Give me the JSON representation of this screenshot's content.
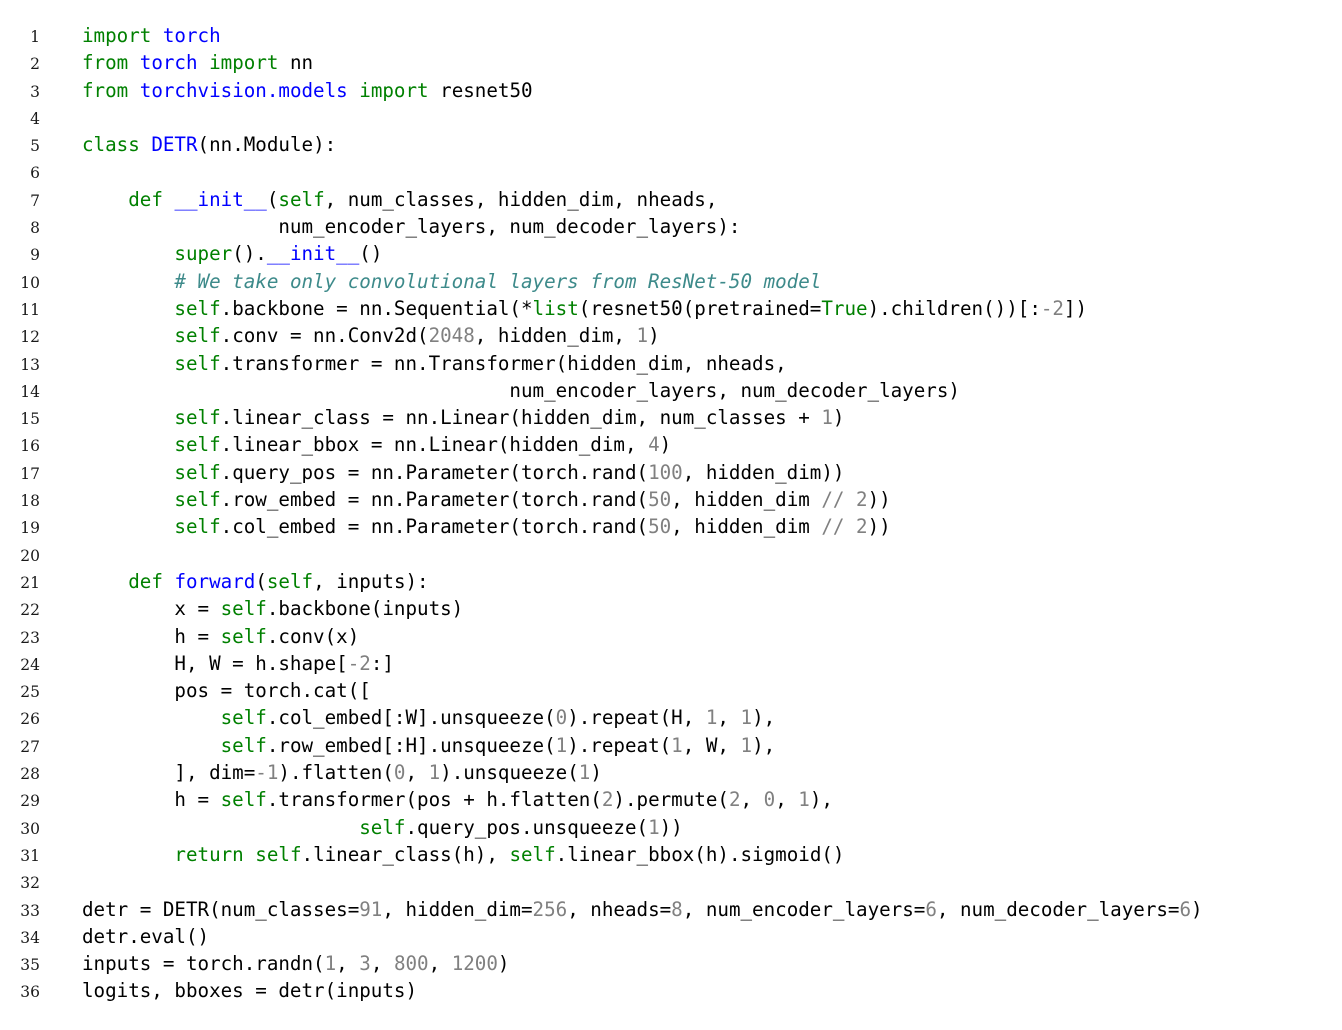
{
  "listing": {
    "language": "python",
    "title": "DETR PyTorch implementation",
    "colors": {
      "background": "#ffffff",
      "plain": "#000000",
      "keyword": "#008000",
      "definition": "#0000ff",
      "number": "#808080",
      "comment": "#3d8a8a",
      "lineno": "#1a1a1a"
    },
    "lines": [
      {
        "n": "1",
        "tokens": [
          {
            "t": "kw",
            "s": "import"
          },
          {
            "t": "pl",
            "s": " "
          },
          {
            "t": "name",
            "s": "torch"
          }
        ]
      },
      {
        "n": "2",
        "tokens": [
          {
            "t": "kw",
            "s": "from"
          },
          {
            "t": "pl",
            "s": " "
          },
          {
            "t": "name",
            "s": "torch"
          },
          {
            "t": "pl",
            "s": " "
          },
          {
            "t": "kw",
            "s": "import"
          },
          {
            "t": "pl",
            "s": " nn"
          }
        ]
      },
      {
        "n": "3",
        "tokens": [
          {
            "t": "kw",
            "s": "from"
          },
          {
            "t": "pl",
            "s": " "
          },
          {
            "t": "name",
            "s": "torchvision.models"
          },
          {
            "t": "pl",
            "s": " "
          },
          {
            "t": "kw",
            "s": "import"
          },
          {
            "t": "pl",
            "s": " resnet50"
          }
        ]
      },
      {
        "n": "4",
        "tokens": []
      },
      {
        "n": "5",
        "tokens": [
          {
            "t": "kw",
            "s": "class"
          },
          {
            "t": "pl",
            "s": " "
          },
          {
            "t": "name",
            "s": "DETR"
          },
          {
            "t": "pl",
            "s": "(nn.Module):"
          }
        ]
      },
      {
        "n": "6",
        "tokens": []
      },
      {
        "n": "7",
        "tokens": [
          {
            "t": "pl",
            "s": "    "
          },
          {
            "t": "kw",
            "s": "def"
          },
          {
            "t": "pl",
            "s": " "
          },
          {
            "t": "name",
            "s": "__init__"
          },
          {
            "t": "pl",
            "s": "("
          },
          {
            "t": "kw",
            "s": "self"
          },
          {
            "t": "pl",
            "s": ", num_classes, hidden_dim, nheads,"
          }
        ]
      },
      {
        "n": "8",
        "tokens": [
          {
            "t": "pl",
            "s": "                 num_encoder_layers, num_decoder_layers):"
          }
        ]
      },
      {
        "n": "9",
        "tokens": [
          {
            "t": "pl",
            "s": "        "
          },
          {
            "t": "kw",
            "s": "super"
          },
          {
            "t": "pl",
            "s": "()."
          },
          {
            "t": "name",
            "s": "__init__"
          },
          {
            "t": "pl",
            "s": "()"
          }
        ]
      },
      {
        "n": "10",
        "tokens": [
          {
            "t": "pl",
            "s": "        "
          },
          {
            "t": "cmt",
            "s": "# We take only convolutional layers from ResNet-50 model"
          }
        ]
      },
      {
        "n": "11",
        "tokens": [
          {
            "t": "pl",
            "s": "        "
          },
          {
            "t": "kw",
            "s": "self"
          },
          {
            "t": "pl",
            "s": ".backbone = nn.Sequential(*"
          },
          {
            "t": "kw",
            "s": "list"
          },
          {
            "t": "pl",
            "s": "(resnet50(pretrained="
          },
          {
            "t": "kw",
            "s": "True"
          },
          {
            "t": "pl",
            "s": ").children())["
          },
          {
            "t": "pl",
            "s": ":"
          },
          {
            "t": "num",
            "s": "-2"
          },
          {
            "t": "pl",
            "s": "])"
          }
        ]
      },
      {
        "n": "12",
        "tokens": [
          {
            "t": "pl",
            "s": "        "
          },
          {
            "t": "kw",
            "s": "self"
          },
          {
            "t": "pl",
            "s": ".conv = nn.Conv2d("
          },
          {
            "t": "num",
            "s": "2048"
          },
          {
            "t": "pl",
            "s": ", hidden_dim, "
          },
          {
            "t": "num",
            "s": "1"
          },
          {
            "t": "pl",
            "s": ")"
          }
        ]
      },
      {
        "n": "13",
        "tokens": [
          {
            "t": "pl",
            "s": "        "
          },
          {
            "t": "kw",
            "s": "self"
          },
          {
            "t": "pl",
            "s": ".transformer = nn.Transformer(hidden_dim, nheads,"
          }
        ]
      },
      {
        "n": "14",
        "tokens": [
          {
            "t": "pl",
            "s": "                                     num_encoder_layers, num_decoder_layers)"
          }
        ]
      },
      {
        "n": "15",
        "tokens": [
          {
            "t": "pl",
            "s": "        "
          },
          {
            "t": "kw",
            "s": "self"
          },
          {
            "t": "pl",
            "s": ".linear_class = nn.Linear(hidden_dim, num_classes + "
          },
          {
            "t": "num",
            "s": "1"
          },
          {
            "t": "pl",
            "s": ")"
          }
        ]
      },
      {
        "n": "16",
        "tokens": [
          {
            "t": "pl",
            "s": "        "
          },
          {
            "t": "kw",
            "s": "self"
          },
          {
            "t": "pl",
            "s": ".linear_bbox = nn.Linear(hidden_dim, "
          },
          {
            "t": "num",
            "s": "4"
          },
          {
            "t": "pl",
            "s": ")"
          }
        ]
      },
      {
        "n": "17",
        "tokens": [
          {
            "t": "pl",
            "s": "        "
          },
          {
            "t": "kw",
            "s": "self"
          },
          {
            "t": "pl",
            "s": ".query_pos = nn.Parameter(torch.rand("
          },
          {
            "t": "num",
            "s": "100"
          },
          {
            "t": "pl",
            "s": ", hidden_dim))"
          }
        ]
      },
      {
        "n": "18",
        "tokens": [
          {
            "t": "pl",
            "s": "        "
          },
          {
            "t": "kw",
            "s": "self"
          },
          {
            "t": "pl",
            "s": ".row_embed = nn.Parameter(torch.rand("
          },
          {
            "t": "num",
            "s": "50"
          },
          {
            "t": "pl",
            "s": ", hidden_dim "
          },
          {
            "t": "num",
            "s": "//"
          },
          {
            "t": "pl",
            "s": " "
          },
          {
            "t": "num",
            "s": "2"
          },
          {
            "t": "pl",
            "s": "))"
          }
        ]
      },
      {
        "n": "19",
        "tokens": [
          {
            "t": "pl",
            "s": "        "
          },
          {
            "t": "kw",
            "s": "self"
          },
          {
            "t": "pl",
            "s": ".col_embed = nn.Parameter(torch.rand("
          },
          {
            "t": "num",
            "s": "50"
          },
          {
            "t": "pl",
            "s": ", hidden_dim "
          },
          {
            "t": "num",
            "s": "//"
          },
          {
            "t": "pl",
            "s": " "
          },
          {
            "t": "num",
            "s": "2"
          },
          {
            "t": "pl",
            "s": "))"
          }
        ]
      },
      {
        "n": "20",
        "tokens": []
      },
      {
        "n": "21",
        "tokens": [
          {
            "t": "pl",
            "s": "    "
          },
          {
            "t": "kw",
            "s": "def"
          },
          {
            "t": "pl",
            "s": " "
          },
          {
            "t": "name",
            "s": "forward"
          },
          {
            "t": "pl",
            "s": "("
          },
          {
            "t": "kw",
            "s": "self"
          },
          {
            "t": "pl",
            "s": ", inputs):"
          }
        ]
      },
      {
        "n": "22",
        "tokens": [
          {
            "t": "pl",
            "s": "        x = "
          },
          {
            "t": "kw",
            "s": "self"
          },
          {
            "t": "pl",
            "s": ".backbone(inputs)"
          }
        ]
      },
      {
        "n": "23",
        "tokens": [
          {
            "t": "pl",
            "s": "        h = "
          },
          {
            "t": "kw",
            "s": "self"
          },
          {
            "t": "pl",
            "s": ".conv(x)"
          }
        ]
      },
      {
        "n": "24",
        "tokens": [
          {
            "t": "pl",
            "s": "        H, W = h.shape["
          },
          {
            "t": "num",
            "s": "-2"
          },
          {
            "t": "pl",
            "s": ":]"
          }
        ]
      },
      {
        "n": "25",
        "tokens": [
          {
            "t": "pl",
            "s": "        pos = torch.cat(["
          }
        ]
      },
      {
        "n": "26",
        "tokens": [
          {
            "t": "pl",
            "s": "            "
          },
          {
            "t": "kw",
            "s": "self"
          },
          {
            "t": "pl",
            "s": ".col_embed[:W].unsqueeze("
          },
          {
            "t": "num",
            "s": "0"
          },
          {
            "t": "pl",
            "s": ").repeat(H, "
          },
          {
            "t": "num",
            "s": "1"
          },
          {
            "t": "pl",
            "s": ", "
          },
          {
            "t": "num",
            "s": "1"
          },
          {
            "t": "pl",
            "s": "),"
          }
        ]
      },
      {
        "n": "27",
        "tokens": [
          {
            "t": "pl",
            "s": "            "
          },
          {
            "t": "kw",
            "s": "self"
          },
          {
            "t": "pl",
            "s": ".row_embed[:H].unsqueeze("
          },
          {
            "t": "num",
            "s": "1"
          },
          {
            "t": "pl",
            "s": ").repeat("
          },
          {
            "t": "num",
            "s": "1"
          },
          {
            "t": "pl",
            "s": ", W, "
          },
          {
            "t": "num",
            "s": "1"
          },
          {
            "t": "pl",
            "s": "),"
          }
        ]
      },
      {
        "n": "28",
        "tokens": [
          {
            "t": "pl",
            "s": "        ], dim="
          },
          {
            "t": "num",
            "s": "-1"
          },
          {
            "t": "pl",
            "s": ").flatten("
          },
          {
            "t": "num",
            "s": "0"
          },
          {
            "t": "pl",
            "s": ", "
          },
          {
            "t": "num",
            "s": "1"
          },
          {
            "t": "pl",
            "s": ").unsqueeze("
          },
          {
            "t": "num",
            "s": "1"
          },
          {
            "t": "pl",
            "s": ")"
          }
        ]
      },
      {
        "n": "29",
        "tokens": [
          {
            "t": "pl",
            "s": "        h = "
          },
          {
            "t": "kw",
            "s": "self"
          },
          {
            "t": "pl",
            "s": ".transformer(pos + h.flatten("
          },
          {
            "t": "num",
            "s": "2"
          },
          {
            "t": "pl",
            "s": ").permute("
          },
          {
            "t": "num",
            "s": "2"
          },
          {
            "t": "pl",
            "s": ", "
          },
          {
            "t": "num",
            "s": "0"
          },
          {
            "t": "pl",
            "s": ", "
          },
          {
            "t": "num",
            "s": "1"
          },
          {
            "t": "pl",
            "s": "),"
          }
        ]
      },
      {
        "n": "30",
        "tokens": [
          {
            "t": "pl",
            "s": "                        "
          },
          {
            "t": "kw",
            "s": "self"
          },
          {
            "t": "pl",
            "s": ".query_pos.unsqueeze("
          },
          {
            "t": "num",
            "s": "1"
          },
          {
            "t": "pl",
            "s": "))"
          }
        ]
      },
      {
        "n": "31",
        "tokens": [
          {
            "t": "pl",
            "s": "        "
          },
          {
            "t": "kw",
            "s": "return"
          },
          {
            "t": "pl",
            "s": " "
          },
          {
            "t": "kw",
            "s": "self"
          },
          {
            "t": "pl",
            "s": ".linear_class(h), "
          },
          {
            "t": "kw",
            "s": "self"
          },
          {
            "t": "pl",
            "s": ".linear_bbox(h).sigmoid()"
          }
        ]
      },
      {
        "n": "32",
        "tokens": []
      },
      {
        "n": "33",
        "tokens": [
          {
            "t": "pl",
            "s": "detr = DETR(num_classes="
          },
          {
            "t": "num",
            "s": "91"
          },
          {
            "t": "pl",
            "s": ", hidden_dim="
          },
          {
            "t": "num",
            "s": "256"
          },
          {
            "t": "pl",
            "s": ", nheads="
          },
          {
            "t": "num",
            "s": "8"
          },
          {
            "t": "pl",
            "s": ", num_encoder_layers="
          },
          {
            "t": "num",
            "s": "6"
          },
          {
            "t": "pl",
            "s": ", num_decoder_layers="
          },
          {
            "t": "num",
            "s": "6"
          },
          {
            "t": "pl",
            "s": ")"
          }
        ]
      },
      {
        "n": "34",
        "tokens": [
          {
            "t": "pl",
            "s": "detr.eval()"
          }
        ]
      },
      {
        "n": "35",
        "tokens": [
          {
            "t": "pl",
            "s": "inputs = torch.randn("
          },
          {
            "t": "num",
            "s": "1"
          },
          {
            "t": "pl",
            "s": ", "
          },
          {
            "t": "num",
            "s": "3"
          },
          {
            "t": "pl",
            "s": ", "
          },
          {
            "t": "num",
            "s": "800"
          },
          {
            "t": "pl",
            "s": ", "
          },
          {
            "t": "num",
            "s": "1200"
          },
          {
            "t": "pl",
            "s": ")"
          }
        ]
      },
      {
        "n": "36",
        "tokens": [
          {
            "t": "pl",
            "s": "logits, bboxes = detr(inputs)"
          }
        ]
      }
    ]
  }
}
